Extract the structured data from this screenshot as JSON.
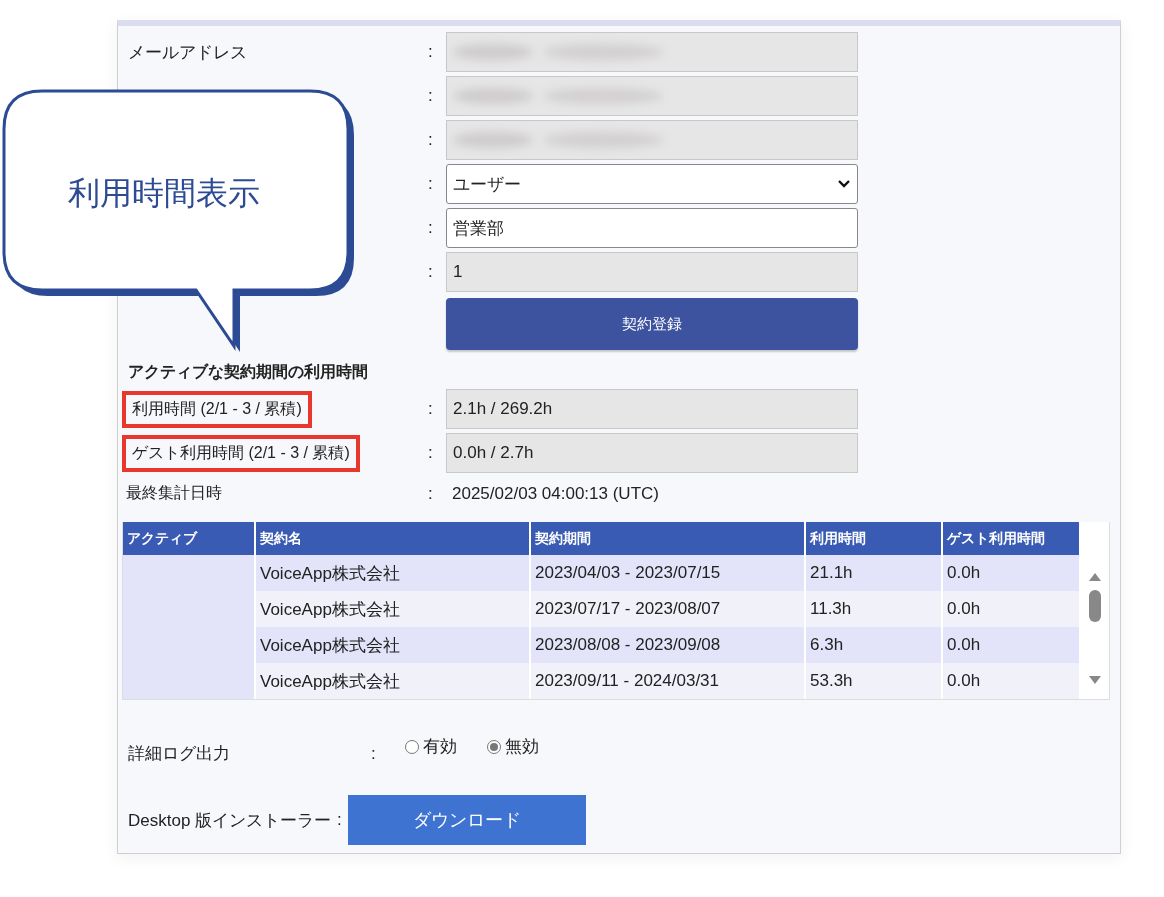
{
  "callout": {
    "text": "利用時間表示"
  },
  "form_rows": [
    {
      "kind": "redacted",
      "label": "メールアドレス",
      "colon": ":"
    },
    {
      "kind": "redacted",
      "colon": ":"
    },
    {
      "kind": "redacted",
      "colon": ":"
    },
    {
      "kind": "select",
      "value": "ユーザー",
      "colon": ":"
    },
    {
      "kind": "input",
      "value": "営業部",
      "colon": ":"
    },
    {
      "kind": "readonly",
      "value": "1",
      "colon": ":"
    },
    {
      "kind": "button",
      "value": "契約登録"
    }
  ],
  "usage": {
    "heading": "アクティブな契約期間の利用時間",
    "rows": [
      {
        "kind": "field",
        "label": "利用時間 (2/1 - 3 / 累積)",
        "value": "2.1h / 269.2h",
        "highlighted": true,
        "colon": ":"
      },
      {
        "kind": "field",
        "label": "ゲスト利用時間 (2/1 - 3 / 累積)",
        "value": "0.0h / 2.7h",
        "highlighted": true,
        "colon": ":"
      },
      {
        "kind": "text",
        "label": "最終集計日時",
        "value": "2025/02/03 04:00:13 (UTC)",
        "highlighted": false,
        "colon": ":"
      }
    ]
  },
  "table": {
    "columns": [
      "アクティブ",
      "契約名",
      "契約期間",
      "利用時間",
      "ゲスト利用時間"
    ],
    "rows": [
      {
        "name": "VoiceApp株式会社",
        "period": "2023/04/03 - 2023/07/15",
        "usage": "21.1h",
        "guest_usage": "0.0h"
      },
      {
        "name": "VoiceApp株式会社",
        "period": "2023/07/17 - 2023/08/07",
        "usage": "11.3h",
        "guest_usage": "0.0h"
      },
      {
        "name": "VoiceApp株式会社",
        "period": "2023/08/08 - 2023/09/08",
        "usage": "6.3h",
        "guest_usage": "0.0h"
      },
      {
        "name": "VoiceApp株式会社",
        "period": "2023/09/11 - 2024/03/31",
        "usage": "53.3h",
        "guest_usage": "0.0h"
      }
    ]
  },
  "log_output": {
    "label": "詳細ログ出力",
    "colon": ":",
    "options": [
      {
        "label": "有効",
        "selected": false
      },
      {
        "label": "無効",
        "selected": true
      }
    ]
  },
  "installer": {
    "label": "Desktop 版インストーラー",
    "colon": ":",
    "button": "ダウンロード"
  }
}
